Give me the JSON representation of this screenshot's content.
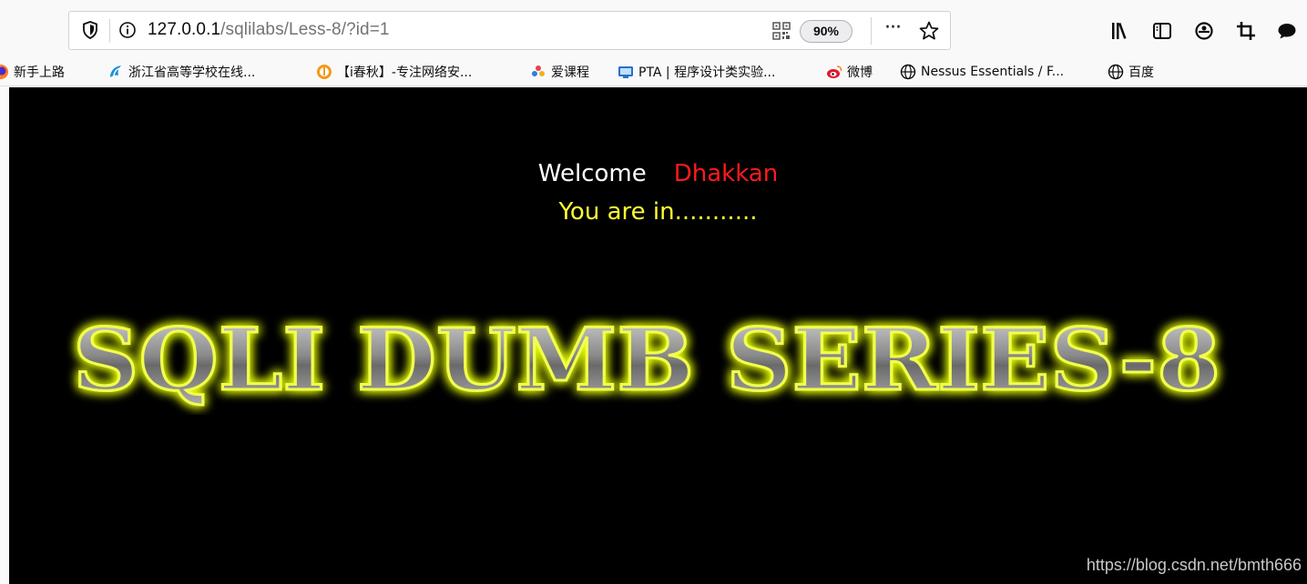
{
  "browser": {
    "url_host": "127.0.0.1",
    "url_path": "/sqlilabs/Less-8/?id=1",
    "zoom": "90%",
    "more_label": "···"
  },
  "bookmarks": [
    {
      "label": "新手上路",
      "icon": "firefox-icon"
    },
    {
      "label": "浙江省高等学校在线...",
      "icon": "course-icon"
    },
    {
      "label": "【i春秋】-专注网络安...",
      "icon": "ichunqiu-icon"
    },
    {
      "label": "爱课程",
      "icon": "icourse-icon"
    },
    {
      "label": "PTA | 程序设计类实验...",
      "icon": "pta-icon"
    },
    {
      "label": "微博",
      "icon": "weibo-icon"
    },
    {
      "label": "Nessus Essentials / F...",
      "icon": "globe-icon"
    },
    {
      "label": "百度",
      "icon": "globe-icon"
    }
  ],
  "page": {
    "welcome_label": "Welcome",
    "username": "Dhakkan",
    "status": "You are in...........",
    "banner_text": "SQLI DUMB SERIES-8",
    "watermark": "https://blog.csdn.net/bmth666"
  },
  "colors": {
    "page_bg": "#000000",
    "welcome": "#ffffff",
    "username": "#ff1a1a",
    "status": "#ffff33",
    "banner_glow": "#e6ff00"
  }
}
